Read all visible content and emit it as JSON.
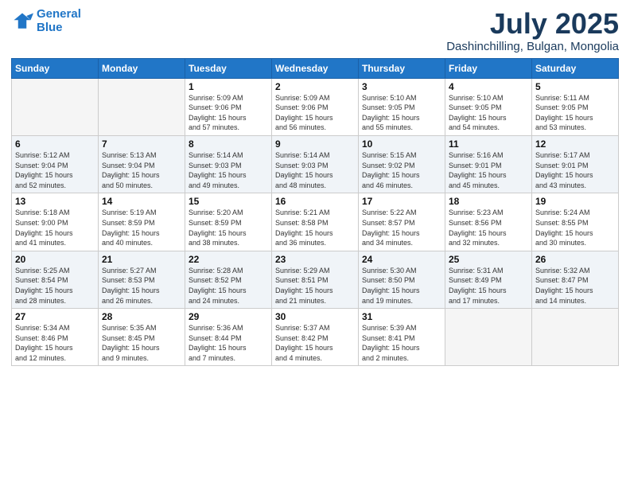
{
  "header": {
    "logo_line1": "General",
    "logo_line2": "Blue",
    "month": "July 2025",
    "location": "Dashinchilling, Bulgan, Mongolia"
  },
  "weekdays": [
    "Sunday",
    "Monday",
    "Tuesday",
    "Wednesday",
    "Thursday",
    "Friday",
    "Saturday"
  ],
  "rows": [
    [
      {
        "day": "",
        "info": ""
      },
      {
        "day": "",
        "info": ""
      },
      {
        "day": "1",
        "info": "Sunrise: 5:09 AM\nSunset: 9:06 PM\nDaylight: 15 hours\nand 57 minutes."
      },
      {
        "day": "2",
        "info": "Sunrise: 5:09 AM\nSunset: 9:06 PM\nDaylight: 15 hours\nand 56 minutes."
      },
      {
        "day": "3",
        "info": "Sunrise: 5:10 AM\nSunset: 9:05 PM\nDaylight: 15 hours\nand 55 minutes."
      },
      {
        "day": "4",
        "info": "Sunrise: 5:10 AM\nSunset: 9:05 PM\nDaylight: 15 hours\nand 54 minutes."
      },
      {
        "day": "5",
        "info": "Sunrise: 5:11 AM\nSunset: 9:05 PM\nDaylight: 15 hours\nand 53 minutes."
      }
    ],
    [
      {
        "day": "6",
        "info": "Sunrise: 5:12 AM\nSunset: 9:04 PM\nDaylight: 15 hours\nand 52 minutes."
      },
      {
        "day": "7",
        "info": "Sunrise: 5:13 AM\nSunset: 9:04 PM\nDaylight: 15 hours\nand 50 minutes."
      },
      {
        "day": "8",
        "info": "Sunrise: 5:14 AM\nSunset: 9:03 PM\nDaylight: 15 hours\nand 49 minutes."
      },
      {
        "day": "9",
        "info": "Sunrise: 5:14 AM\nSunset: 9:03 PM\nDaylight: 15 hours\nand 48 minutes."
      },
      {
        "day": "10",
        "info": "Sunrise: 5:15 AM\nSunset: 9:02 PM\nDaylight: 15 hours\nand 46 minutes."
      },
      {
        "day": "11",
        "info": "Sunrise: 5:16 AM\nSunset: 9:01 PM\nDaylight: 15 hours\nand 45 minutes."
      },
      {
        "day": "12",
        "info": "Sunrise: 5:17 AM\nSunset: 9:01 PM\nDaylight: 15 hours\nand 43 minutes."
      }
    ],
    [
      {
        "day": "13",
        "info": "Sunrise: 5:18 AM\nSunset: 9:00 PM\nDaylight: 15 hours\nand 41 minutes."
      },
      {
        "day": "14",
        "info": "Sunrise: 5:19 AM\nSunset: 8:59 PM\nDaylight: 15 hours\nand 40 minutes."
      },
      {
        "day": "15",
        "info": "Sunrise: 5:20 AM\nSunset: 8:59 PM\nDaylight: 15 hours\nand 38 minutes."
      },
      {
        "day": "16",
        "info": "Sunrise: 5:21 AM\nSunset: 8:58 PM\nDaylight: 15 hours\nand 36 minutes."
      },
      {
        "day": "17",
        "info": "Sunrise: 5:22 AM\nSunset: 8:57 PM\nDaylight: 15 hours\nand 34 minutes."
      },
      {
        "day": "18",
        "info": "Sunrise: 5:23 AM\nSunset: 8:56 PM\nDaylight: 15 hours\nand 32 minutes."
      },
      {
        "day": "19",
        "info": "Sunrise: 5:24 AM\nSunset: 8:55 PM\nDaylight: 15 hours\nand 30 minutes."
      }
    ],
    [
      {
        "day": "20",
        "info": "Sunrise: 5:25 AM\nSunset: 8:54 PM\nDaylight: 15 hours\nand 28 minutes."
      },
      {
        "day": "21",
        "info": "Sunrise: 5:27 AM\nSunset: 8:53 PM\nDaylight: 15 hours\nand 26 minutes."
      },
      {
        "day": "22",
        "info": "Sunrise: 5:28 AM\nSunset: 8:52 PM\nDaylight: 15 hours\nand 24 minutes."
      },
      {
        "day": "23",
        "info": "Sunrise: 5:29 AM\nSunset: 8:51 PM\nDaylight: 15 hours\nand 21 minutes."
      },
      {
        "day": "24",
        "info": "Sunrise: 5:30 AM\nSunset: 8:50 PM\nDaylight: 15 hours\nand 19 minutes."
      },
      {
        "day": "25",
        "info": "Sunrise: 5:31 AM\nSunset: 8:49 PM\nDaylight: 15 hours\nand 17 minutes."
      },
      {
        "day": "26",
        "info": "Sunrise: 5:32 AM\nSunset: 8:47 PM\nDaylight: 15 hours\nand 14 minutes."
      }
    ],
    [
      {
        "day": "27",
        "info": "Sunrise: 5:34 AM\nSunset: 8:46 PM\nDaylight: 15 hours\nand 12 minutes."
      },
      {
        "day": "28",
        "info": "Sunrise: 5:35 AM\nSunset: 8:45 PM\nDaylight: 15 hours\nand 9 minutes."
      },
      {
        "day": "29",
        "info": "Sunrise: 5:36 AM\nSunset: 8:44 PM\nDaylight: 15 hours\nand 7 minutes."
      },
      {
        "day": "30",
        "info": "Sunrise: 5:37 AM\nSunset: 8:42 PM\nDaylight: 15 hours\nand 4 minutes."
      },
      {
        "day": "31",
        "info": "Sunrise: 5:39 AM\nSunset: 8:41 PM\nDaylight: 15 hours\nand 2 minutes."
      },
      {
        "day": "",
        "info": ""
      },
      {
        "day": "",
        "info": ""
      }
    ]
  ]
}
